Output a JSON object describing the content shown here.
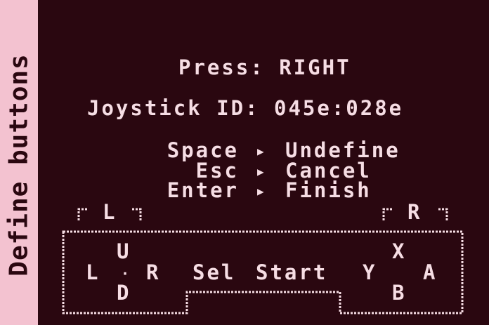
{
  "sidebar": {
    "title": "Define buttons"
  },
  "prompt": {
    "label": "Press:",
    "button": "RIGHT"
  },
  "joystick": {
    "label": "Joystick ID:",
    "id": "045e:028e"
  },
  "hints": [
    {
      "key": "Space",
      "action": "Undefine"
    },
    {
      "key": "Esc",
      "action": "Cancel"
    },
    {
      "key": "Enter",
      "action": "Finish"
    }
  ],
  "controller": {
    "shoulder_left": "L",
    "shoulder_right": "R",
    "dpad_up": "U",
    "dpad_down": "D",
    "dpad_left": "L",
    "dpad_right": "R",
    "select": "Sel",
    "start": "Start",
    "x": "X",
    "y": "Y",
    "a": "A",
    "b": "B"
  },
  "colors": {
    "background": "#2a0710",
    "sidebar": "#f3c2d0",
    "text": "#f6dde4"
  },
  "icons": {
    "hint_arrow": "right-triangle-icon"
  }
}
